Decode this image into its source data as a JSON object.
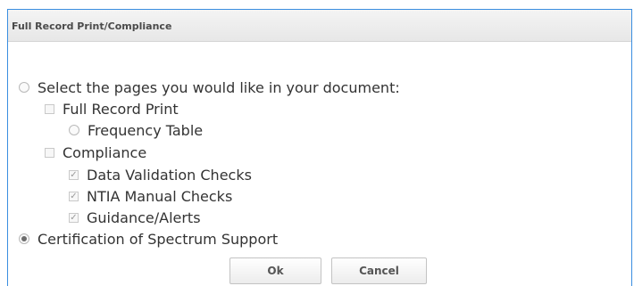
{
  "dialog": {
    "title": "Full Record Print/Compliance"
  },
  "options": {
    "select_pages": {
      "label": "Select the pages you would like in your document:",
      "checked": false
    },
    "full_record_print": {
      "label": "Full Record Print",
      "checked": false
    },
    "frequency_table": {
      "label": "Frequency Table",
      "checked": false
    },
    "compliance": {
      "label": "Compliance",
      "checked": false
    },
    "data_validation_checks": {
      "label": "Data Validation Checks",
      "checked": true
    },
    "ntia_manual_checks": {
      "label": "NTIA Manual Checks",
      "checked": true
    },
    "guidance_alerts": {
      "label": "Guidance/Alerts",
      "checked": true
    },
    "certification": {
      "label": "Certification of Spectrum Support",
      "checked": true
    }
  },
  "buttons": {
    "ok": "Ok",
    "cancel": "Cancel"
  },
  "colors": {
    "border_accent": "#3a8ee0"
  }
}
